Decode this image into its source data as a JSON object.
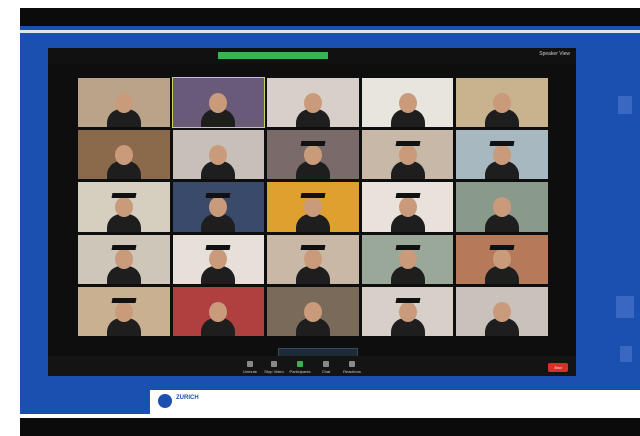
{
  "zoom": {
    "top_right_label": "Speaker View",
    "recording_label": "",
    "tiles": [
      {
        "label": "",
        "cap": false
      },
      {
        "label": "",
        "cap": false
      },
      {
        "label": "",
        "cap": false
      },
      {
        "label": "",
        "cap": false
      },
      {
        "label": "",
        "cap": false
      },
      {
        "label": "",
        "cap": false
      },
      {
        "label": "",
        "cap": false
      },
      {
        "label": "",
        "cap": true
      },
      {
        "label": "",
        "cap": true
      },
      {
        "label": "",
        "cap": true
      },
      {
        "label": "",
        "cap": true
      },
      {
        "label": "",
        "cap": true
      },
      {
        "label": "",
        "cap": true
      },
      {
        "label": "",
        "cap": true
      },
      {
        "label": "",
        "cap": false
      },
      {
        "label": "",
        "cap": true
      },
      {
        "label": "",
        "cap": true
      },
      {
        "label": "",
        "cap": true
      },
      {
        "label": "",
        "cap": true
      },
      {
        "label": "",
        "cap": true
      },
      {
        "label": "",
        "cap": true
      },
      {
        "label": "",
        "cap": false
      },
      {
        "label": "",
        "cap": false
      },
      {
        "label": "",
        "cap": true
      },
      {
        "label": "",
        "cap": false
      }
    ],
    "popup": {
      "text": "",
      "button": ""
    },
    "toolbar": {
      "items": [
        "Unmute",
        "Stop Video",
        "Participants",
        "Chat",
        "Reactions"
      ],
      "end_label": "End"
    }
  },
  "sponsors": {
    "label_1": "",
    "brand": "ZURICH",
    "label_2": ""
  },
  "colors": {
    "stage": "#1b4fb0",
    "end": "#d93025",
    "recording": "#3db14f"
  }
}
